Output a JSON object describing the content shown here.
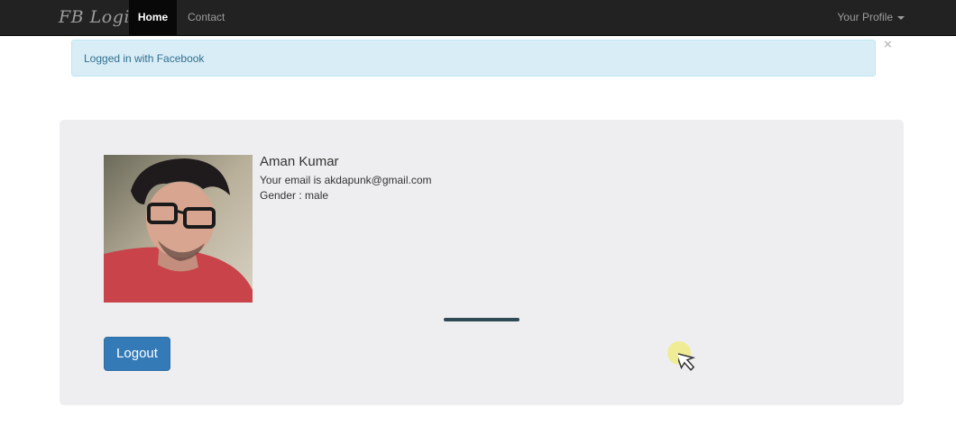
{
  "navbar": {
    "brand": "FB Login",
    "items": [
      {
        "label": "Home",
        "active": true
      },
      {
        "label": "Contact",
        "active": false
      }
    ],
    "profile_label": "Your Profile"
  },
  "alert": {
    "text": "Logged in with Facebook",
    "close_glyph": "×"
  },
  "profile": {
    "name": "Aman Kumar",
    "email_line": "Your email is akdapunk@gmail.com",
    "gender_line": "Gender : male",
    "logout_label": "Logout"
  },
  "colors": {
    "navbar_bg": "#222222",
    "alert_bg": "#d9edf7",
    "panel_bg": "#eeeef0",
    "button_primary": "#337ab7"
  }
}
